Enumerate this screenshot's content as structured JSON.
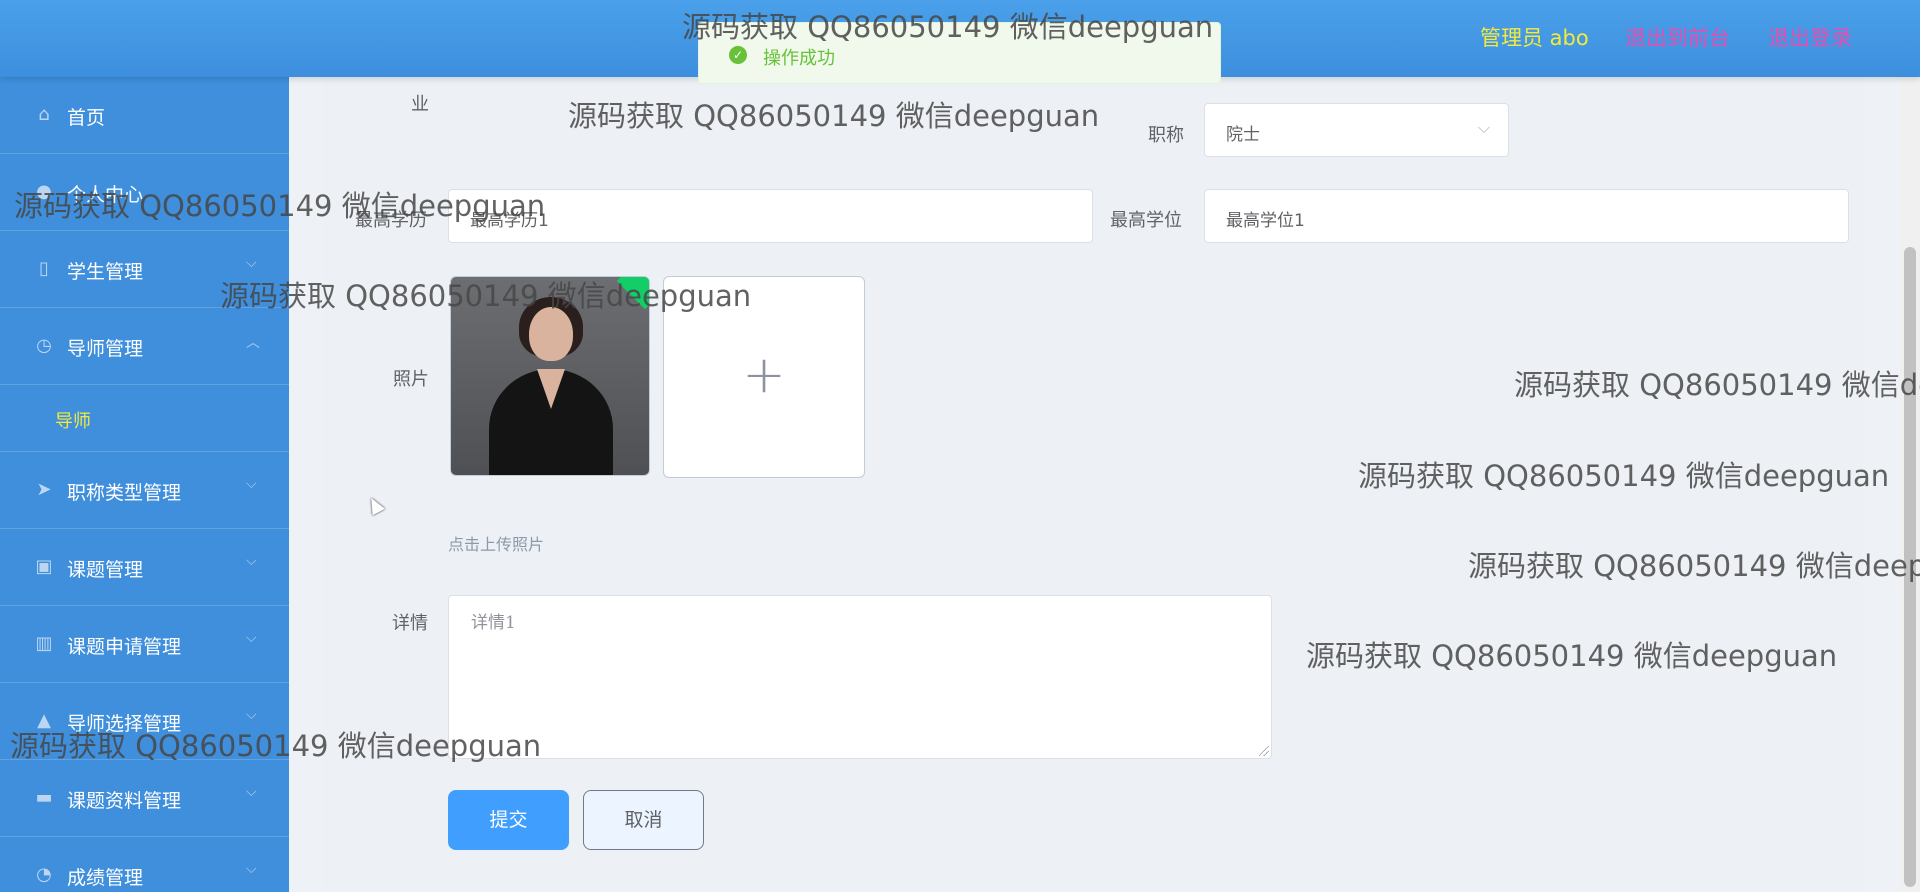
{
  "header": {
    "user_label": "管理员 abo",
    "front_link": "退出到前台",
    "logout_link": "退出登录"
  },
  "toast": {
    "icon": "success-check-icon",
    "message": "操作成功"
  },
  "sidebar": {
    "items": [
      {
        "label": "首页",
        "icon": "home-icon"
      },
      {
        "label": "个人中心",
        "icon": "user-icon"
      },
      {
        "label": "学生管理",
        "icon": "phone-icon"
      },
      {
        "label": "导师管理",
        "icon": "clock-icon"
      },
      {
        "label": "职称类型管理",
        "icon": "send-icon"
      },
      {
        "label": "课题管理",
        "icon": "clipboard-icon"
      },
      {
        "label": "课题申请管理",
        "icon": "chart-icon"
      },
      {
        "label": "导师选择管理",
        "icon": "lock-icon"
      },
      {
        "label": "课题资料管理",
        "icon": "chat-icon"
      },
      {
        "label": "成绩管理",
        "icon": "gauge-icon"
      }
    ],
    "sub_item": "导师"
  },
  "form": {
    "partial_label": "业",
    "title_label": "职称",
    "title_value": "院士",
    "degree_label": "最高学历",
    "degree_value": "最高学历1",
    "top_degree_label": "最高学位",
    "top_degree_value": "最高学位1",
    "photo_label": "照片",
    "upload_hint": "点击上传照片",
    "detail_label": "详情",
    "detail_value": "详情1",
    "submit_label": "提交",
    "cancel_label": "取消"
  },
  "watermark": "源码获取 QQ86050149 微信deepguan"
}
